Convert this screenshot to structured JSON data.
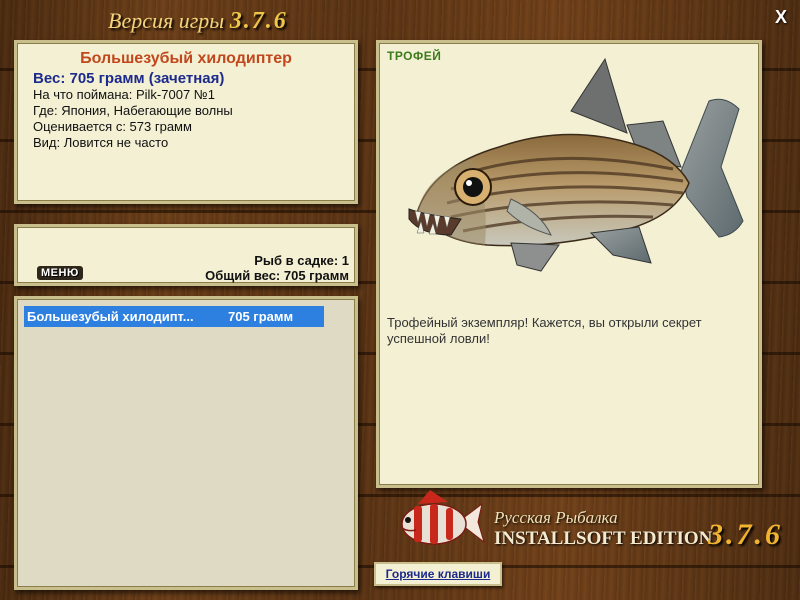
{
  "header": {
    "title_prefix": "Версия игры",
    "version": "3.7.6",
    "close_label": "X"
  },
  "fish_info": {
    "name": "Большезубый хилодиптер",
    "weight": "Вес: 705 грамм (зачетная)",
    "lines": [
      "На что поймана: Pilk-7007 №1",
      "Где: Япония, Набегающие волны",
      "Оценивается с: 573 грамм",
      "Вид: Ловится не часто"
    ]
  },
  "keepnet": {
    "menu_label": "МЕНЮ",
    "count": "Рыб в садке: 1",
    "total": "Общий вес: 705 грамм"
  },
  "catch_list": [
    {
      "name": "Большезубый хилодипт...",
      "weight": "705 грамм",
      "selected": true
    }
  ],
  "detail": {
    "badge": "ТРОФЕЙ",
    "description": "Трофейный экземпляр! Кажется, вы открыли секрет успешной ловли!",
    "image": "fish-illustration"
  },
  "branding": {
    "line1": "Русская Рыбалка",
    "line2": "INSTALLSOFT EDITION",
    "version": "3.7.6"
  },
  "footer": {
    "hotkeys_label": "Горячие клавиши"
  },
  "colors": {
    "accent_orange": "#c0481c",
    "accent_blue": "#1c2a8c",
    "trophy_green": "#3c7a1c",
    "selection_blue": "#2d7fe0",
    "panel_bg": "#f4f0d4"
  }
}
